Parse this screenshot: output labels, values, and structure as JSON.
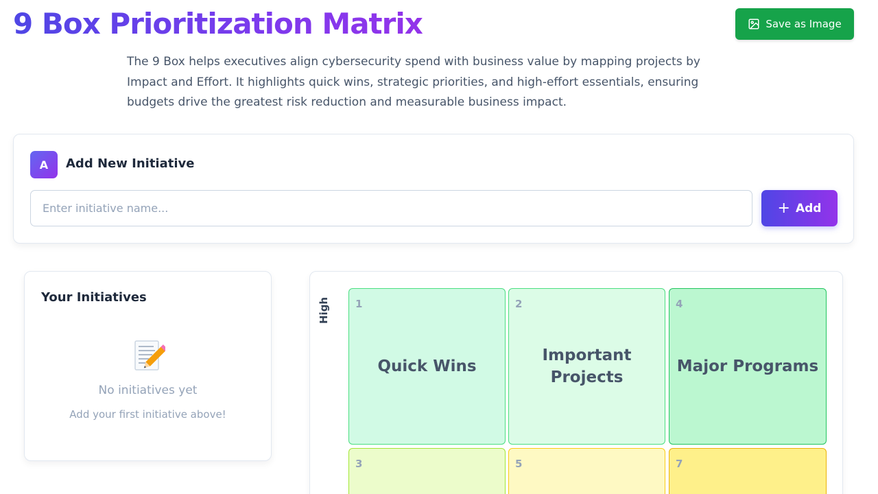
{
  "header": {
    "title": "9 Box Prioritization Matrix",
    "save_label": "Save as Image",
    "description": "The 9 Box helps executives align cybersecurity spend with business value by mapping projects by Impact and Effort. It highlights quick wins, strategic priorities, and high-effort essentials, ensuring budgets drive the greatest risk reduction and measurable business impact."
  },
  "add_initiative": {
    "step_badge": "A",
    "title": "Add New Initiative",
    "input_placeholder": "Enter initiative name...",
    "input_value": "",
    "add_label": "Add"
  },
  "initiatives": {
    "title": "Your Initiatives",
    "empty_icon": "memo-icon",
    "empty_title": "No initiatives yet",
    "empty_subtitle": "Add your first initiative above!",
    "items": []
  },
  "matrix": {
    "y_axis_high_label": "High",
    "cells": [
      {
        "number": "1",
        "label": "Quick Wins",
        "color": "#d1fae5"
      },
      {
        "number": "2",
        "label": "Important Projects",
        "color": "#dcfce7"
      },
      {
        "number": "4",
        "label": "Major Programs",
        "color": "#bbf7d0"
      },
      {
        "number": "3",
        "label": "",
        "color": "#ecfccb"
      },
      {
        "number": "5",
        "label": "",
        "color": "#fef9c3"
      },
      {
        "number": "7",
        "label": "",
        "color": "#fef08a"
      }
    ]
  },
  "colors": {
    "title_gradient_start": "#4f46e5",
    "title_gradient_end": "#9333ea",
    "save_button": "#16a34a",
    "add_button_start": "#4f46e5",
    "add_button_end": "#9333ea"
  }
}
